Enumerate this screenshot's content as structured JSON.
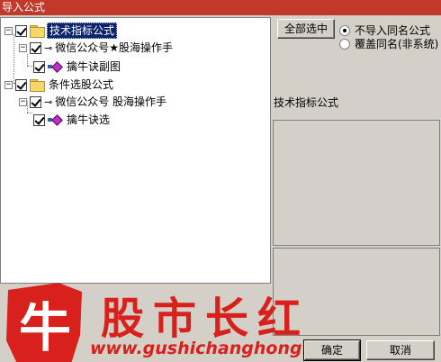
{
  "window": {
    "title": "导入公式"
  },
  "tree": {
    "groups": [
      {
        "label": "技术指标公式",
        "checked": true,
        "selected": true,
        "children": [
          {
            "label": "微信公众号★股海操作手",
            "checked": true,
            "children": [
              {
                "label": "擒牛诀副图",
                "checked": true
              }
            ]
          }
        ]
      },
      {
        "label": "条件选股公式",
        "checked": true,
        "selected": false,
        "children": [
          {
            "label": "微信公众号 股海操作手",
            "checked": true,
            "children": [
              {
                "label": "擒牛诀选",
                "checked": true
              }
            ]
          }
        ]
      }
    ],
    "expander_symbol": "−"
  },
  "options": {
    "select_all_label": "全部选中",
    "radio_no_import": "不导入同名公式",
    "radio_overwrite": "覆盖同名(非系统)",
    "selected_radio": "no_import"
  },
  "detail": {
    "section_label": "技术指标公式"
  },
  "footer": {
    "ok_label": "确定",
    "cancel_label": "取消"
  },
  "watermark": {
    "badge_char": "牛",
    "title": "股市长红",
    "url": "www.gushichanghong.com",
    "color": "#d8201c"
  },
  "colors": {
    "titlebar": "#c0392b",
    "selection": "#0a246a",
    "dialog_bg": "#d4d0c8"
  }
}
